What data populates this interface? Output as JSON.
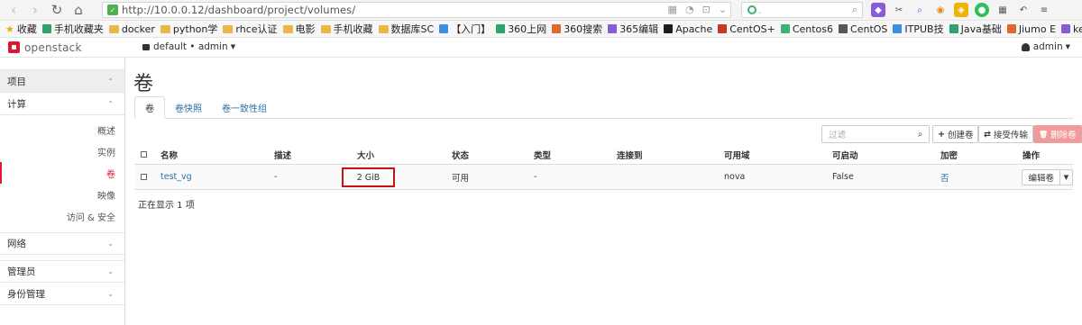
{
  "browser": {
    "back_glyph": "‹",
    "forward_glyph": "›",
    "reload_glyph": "↻",
    "home_glyph": "⌂",
    "url": "http://10.0.0.12/dashboard/project/volumes/",
    "url_icon_1": "▦",
    "url_icon_2": "◔",
    "url_icon_3": "⊡",
    "url_icon_4": "⌄",
    "search_magnifier": "⌕",
    "search_placeholder": "."
  },
  "bookmarks": [
    {
      "label": "收藏",
      "icon": "star"
    },
    {
      "label": "手机收藏夹",
      "icon": "page"
    },
    {
      "label": "docker",
      "icon": "folder"
    },
    {
      "label": "python学",
      "icon": "folder"
    },
    {
      "label": "rhce认证",
      "icon": "folder"
    },
    {
      "label": "电影",
      "icon": "folder"
    },
    {
      "label": "手机收藏",
      "icon": "folder"
    },
    {
      "label": "数据库SC",
      "icon": "folder"
    },
    {
      "label": "【入门】",
      "icon": "page"
    },
    {
      "label": "360上网",
      "icon": "page"
    },
    {
      "label": "360搜索",
      "icon": "page"
    },
    {
      "label": "365编辑",
      "icon": "page"
    },
    {
      "label": "Apache",
      "icon": "page"
    },
    {
      "label": "CentOS+",
      "icon": "page"
    },
    {
      "label": "Centos6",
      "icon": "page"
    },
    {
      "label": "CentOS",
      "icon": "page"
    },
    {
      "label": "ITPUB技",
      "icon": "page"
    },
    {
      "label": "Java基础",
      "icon": "page"
    },
    {
      "label": "Jiumo E",
      "icon": "page"
    },
    {
      "label": "keepaliv",
      "icon": "page"
    },
    {
      "label": "»",
      "icon": "none"
    }
  ],
  "header": {
    "logo": "openstack",
    "project": "default • admin",
    "caret": "▼",
    "user": "admin"
  },
  "sidebar": {
    "chev_up": "⌃",
    "chev_down": "⌄",
    "sections": [
      {
        "label": "项目"
      },
      {
        "label": "计算"
      }
    ],
    "compute_items": [
      {
        "label": "概述"
      },
      {
        "label": "实例"
      },
      {
        "label": "卷"
      },
      {
        "label": "映像"
      },
      {
        "label": "访问 & 安全"
      }
    ],
    "other_sections": [
      {
        "label": "网络"
      },
      {
        "label": "管理员"
      },
      {
        "label": "身份管理"
      }
    ]
  },
  "main": {
    "title": "卷",
    "tabs": [
      {
        "label": "卷"
      },
      {
        "label": "卷快照"
      },
      {
        "label": "卷一致性组"
      }
    ],
    "filter_placeholder": "过滤",
    "filter_glyph": "⌕",
    "create_glyph": "+",
    "create_label": "创建卷",
    "accept_glyph": "⇄",
    "accept_label": "接受传输",
    "delete_glyph": "🗑",
    "delete_label": "删除卷",
    "columns": [
      "名称",
      "描述",
      "大小",
      "状态",
      "类型",
      "连接到",
      "可用域",
      "可启动",
      "加密",
      "操作"
    ],
    "rows": [
      {
        "name": "test_vg",
        "description": "-",
        "size": "2 GiB",
        "status": "可用",
        "type": "-",
        "attached": "",
        "zone": "nova",
        "bootable": "False",
        "encrypted": "否",
        "action": "编辑卷",
        "action_caret": "▼"
      }
    ],
    "count_text": "正在显示 1 项"
  },
  "colors": {
    "brand": "#da1a32",
    "link": "#2b6ea3",
    "highlight_box": "#cc1111"
  }
}
